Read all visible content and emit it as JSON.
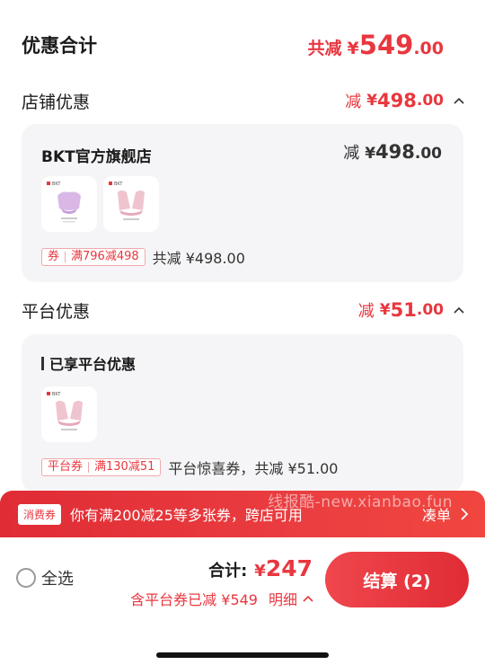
{
  "summary": {
    "title": "优惠合计",
    "prefix": "共减",
    "currency": "¥",
    "integer": "549",
    "decimal": ".00"
  },
  "store_section": {
    "title": "店铺优惠",
    "prefix": "减",
    "currency": "¥",
    "integer": "498",
    "decimal": ".00",
    "card": {
      "store_name": "BKT官方旗舰店",
      "discount_prefix": "减",
      "discount_currency": "¥",
      "discount_integer": "498",
      "discount_decimal": ".00",
      "coupon_label": "券",
      "coupon_rule": "满796减498",
      "coupon_total": "共减 ¥498.00"
    }
  },
  "platform_section": {
    "title": "平台优惠",
    "prefix": "减",
    "currency": "¥",
    "integer": "51",
    "decimal": ".00",
    "card": {
      "enjoyed_title": "已享平台优惠",
      "coupon_label": "平台券",
      "coupon_rule": "满130减51",
      "coupon_total": "平台惊喜券，共减 ¥51.00"
    }
  },
  "promo_banner": {
    "badge": "消费券",
    "text": "你有满200减25等多张券，跨店可用",
    "link": "凑单",
    "watermark": "线报酷-new.xianbao.fun"
  },
  "checkout": {
    "select_all": "全选",
    "total_label": "合计:",
    "total_currency": "¥",
    "total_amount": "247",
    "saved_text": "含平台券已减 ¥549",
    "detail_label": "明细",
    "button_label": "结算 (2)"
  },
  "product_thumbnails": {
    "brand_mark": "BKT"
  },
  "colors": {
    "accent": "#e8373f",
    "card_background": "#f5f5f7",
    "banner_red": "#e02c35"
  },
  "icons": {
    "section_toggle": "chevron-up-icon",
    "promo_link": "chevron-right-icon",
    "select_all": "radio-circle-icon"
  }
}
